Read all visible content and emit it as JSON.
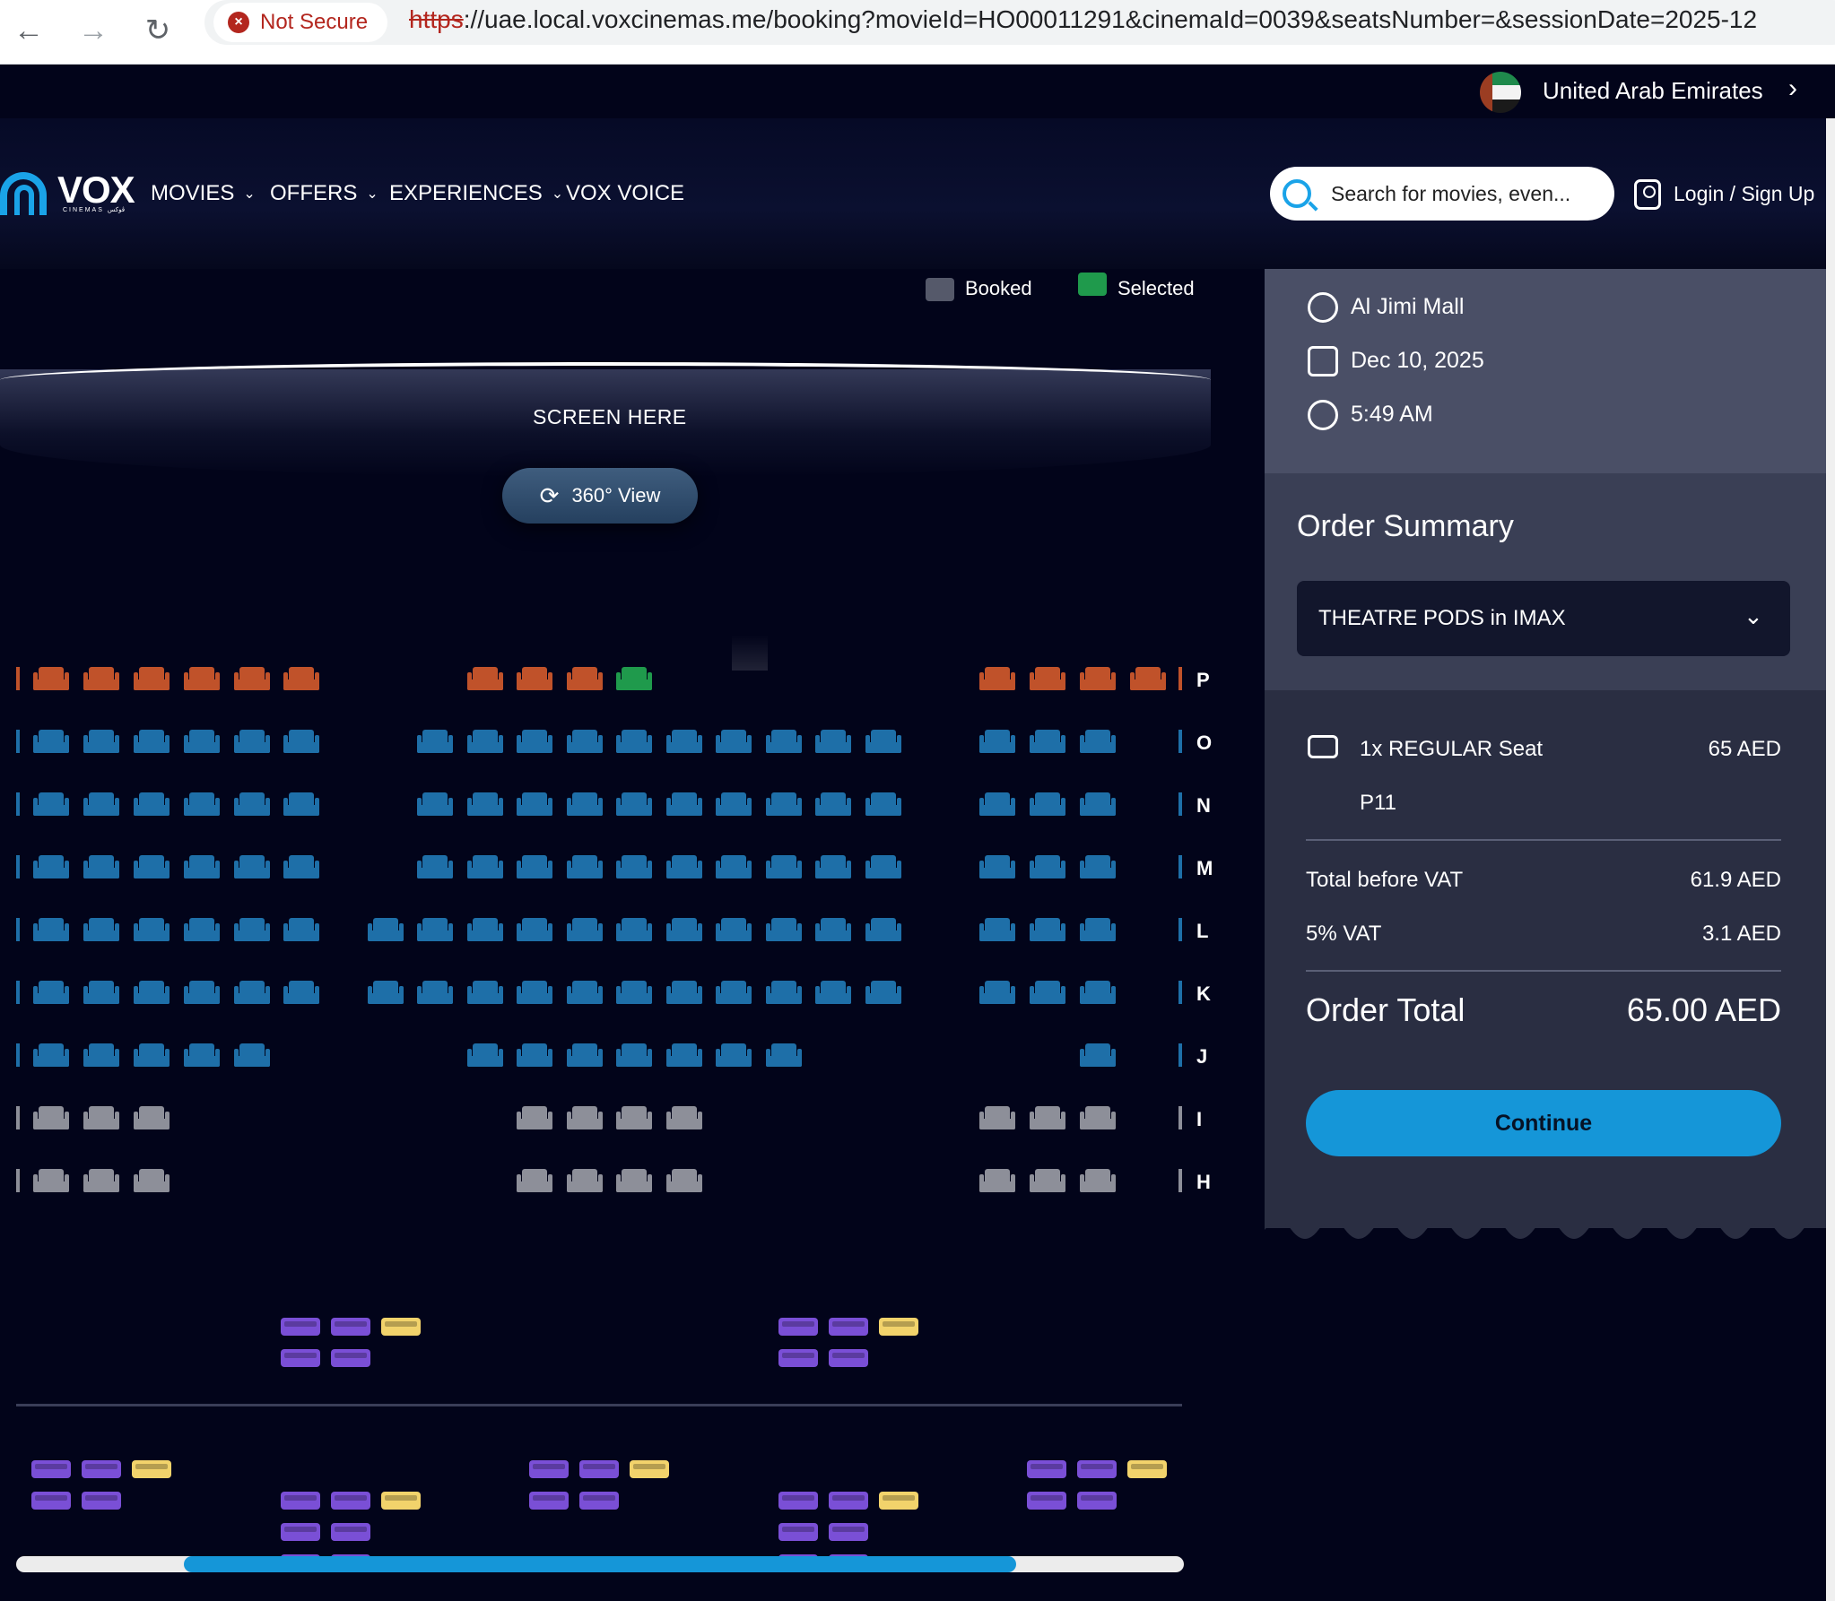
{
  "browser": {
    "security_label": "Not Secure",
    "url_scheme": "https",
    "url_rest": "://uae.local.voxcinemas.me/booking?movieId=HO00011291&cinemaId=0039&seatsNumber=&sessionDate=2025-12"
  },
  "region": {
    "label": "United Arab Emirates"
  },
  "header": {
    "logo": "VOX",
    "logo_sub": "CINEMAS ڤوكس",
    "nav": [
      {
        "label": "MOVIES",
        "has_dropdown": true
      },
      {
        "label": "OFFERS",
        "has_dropdown": true
      },
      {
        "label": "EXPERIENCES",
        "has_dropdown": true
      },
      {
        "label": "VOX VOICE",
        "has_dropdown": false
      }
    ],
    "search_placeholder": "Search for movies, even...",
    "login_label": "Login / Sign Up"
  },
  "legend": {
    "booked_label": "Booked",
    "selected_label": "Selected"
  },
  "screen": {
    "label": "SCREEN HERE",
    "view_button": "360° View"
  },
  "seat_map": {
    "colors": {
      "orange": "#c0522a",
      "blue": "#1e6fa8",
      "gray": "#8d8f99",
      "green": "#1f9a4c",
      "purple": "#7a4fd6",
      "yellow": "#f2d36b"
    },
    "rows": [
      "P",
      "O",
      "N",
      "M",
      "L",
      "K",
      "J",
      "I",
      "H"
    ],
    "selected_seat": "P11"
  },
  "session": {
    "cinema": "Al Jimi Mall",
    "date": "Dec 10, 2025",
    "time": "5:49 AM"
  },
  "order": {
    "title": "Order Summary",
    "experience": "THEATRE PODS in IMAX",
    "item_label": "1x REGULAR Seat",
    "item_price": "65 AED",
    "item_seat": "P11",
    "before_vat_label": "Total before VAT",
    "before_vat_value": "61.9 AED",
    "vat_label": "5% VAT",
    "vat_value": "3.1 AED",
    "total_label": "Order Total",
    "total_value": "65.00 AED",
    "continue_label": "Continue"
  }
}
